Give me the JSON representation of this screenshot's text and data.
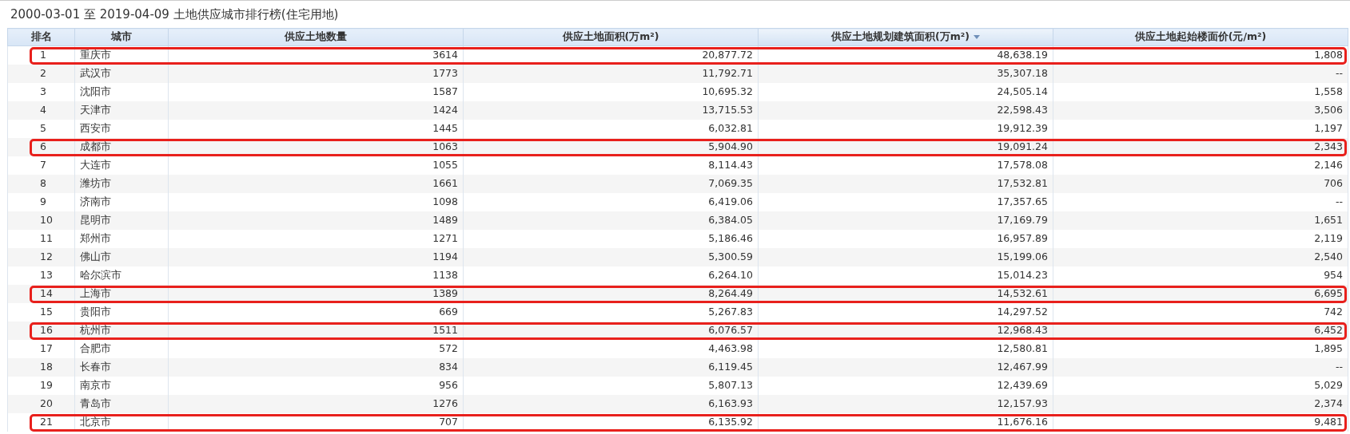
{
  "title": "2000-03-01  至  2019-04-09  土地供应城市排行榜(住宅用地)",
  "table": {
    "columns": [
      {
        "label": "排名",
        "sorted": false
      },
      {
        "label": "城市",
        "sorted": false
      },
      {
        "label": "供应土地数量",
        "sorted": false
      },
      {
        "label": "供应土地面积(万m²)",
        "sorted": false
      },
      {
        "label": "供应土地规划建筑面积(万m²)",
        "sorted": true
      },
      {
        "label": "供应土地起始楼面价(元/m²)",
        "sorted": false
      }
    ],
    "rows": [
      {
        "cells": [
          "1",
          "重庆市",
          "3614",
          "20,877.72",
          "48,638.19",
          "1,808"
        ],
        "highlighted": true
      },
      {
        "cells": [
          "2",
          "武汉市",
          "1773",
          "11,792.71",
          "35,307.18",
          "--"
        ],
        "highlighted": false
      },
      {
        "cells": [
          "3",
          "沈阳市",
          "1587",
          "10,695.32",
          "24,505.14",
          "1,558"
        ],
        "highlighted": false
      },
      {
        "cells": [
          "4",
          "天津市",
          "1424",
          "13,715.53",
          "22,598.43",
          "3,506"
        ],
        "highlighted": false
      },
      {
        "cells": [
          "5",
          "西安市",
          "1445",
          "6,032.81",
          "19,912.39",
          "1,197"
        ],
        "highlighted": false
      },
      {
        "cells": [
          "6",
          "成都市",
          "1063",
          "5,904.90",
          "19,091.24",
          "2,343"
        ],
        "highlighted": true
      },
      {
        "cells": [
          "7",
          "大连市",
          "1055",
          "8,114.43",
          "17,578.08",
          "2,146"
        ],
        "highlighted": false
      },
      {
        "cells": [
          "8",
          "潍坊市",
          "1661",
          "7,069.35",
          "17,532.81",
          "706"
        ],
        "highlighted": false
      },
      {
        "cells": [
          "9",
          "济南市",
          "1098",
          "6,419.06",
          "17,357.65",
          "--"
        ],
        "highlighted": false
      },
      {
        "cells": [
          "10",
          "昆明市",
          "1489",
          "6,384.05",
          "17,169.79",
          "1,651"
        ],
        "highlighted": false
      },
      {
        "cells": [
          "11",
          "郑州市",
          "1271",
          "5,186.46",
          "16,957.89",
          "2,119"
        ],
        "highlighted": false
      },
      {
        "cells": [
          "12",
          "佛山市",
          "1194",
          "5,300.59",
          "15,199.06",
          "2,540"
        ],
        "highlighted": false
      },
      {
        "cells": [
          "13",
          "哈尔滨市",
          "1138",
          "6,264.10",
          "15,014.23",
          "954"
        ],
        "highlighted": false
      },
      {
        "cells": [
          "14",
          "上海市",
          "1389",
          "8,264.49",
          "14,532.61",
          "6,695"
        ],
        "highlighted": true
      },
      {
        "cells": [
          "15",
          "贵阳市",
          "669",
          "5,267.83",
          "14,297.52",
          "742"
        ],
        "highlighted": false
      },
      {
        "cells": [
          "16",
          "杭州市",
          "1511",
          "6,076.57",
          "12,968.43",
          "6,452"
        ],
        "highlighted": true
      },
      {
        "cells": [
          "17",
          "合肥市",
          "572",
          "4,463.98",
          "12,580.81",
          "1,895"
        ],
        "highlighted": false
      },
      {
        "cells": [
          "18",
          "长春市",
          "834",
          "6,119.45",
          "12,467.99",
          "--"
        ],
        "highlighted": false
      },
      {
        "cells": [
          "19",
          "南京市",
          "956",
          "5,807.13",
          "12,439.69",
          "5,029"
        ],
        "highlighted": false
      },
      {
        "cells": [
          "20",
          "青岛市",
          "1276",
          "6,163.93",
          "12,157.93",
          "2,374"
        ],
        "highlighted": false
      },
      {
        "cells": [
          "21",
          "北京市",
          "707",
          "6,135.92",
          "11,676.16",
          "9,481"
        ],
        "highlighted": true
      }
    ]
  }
}
